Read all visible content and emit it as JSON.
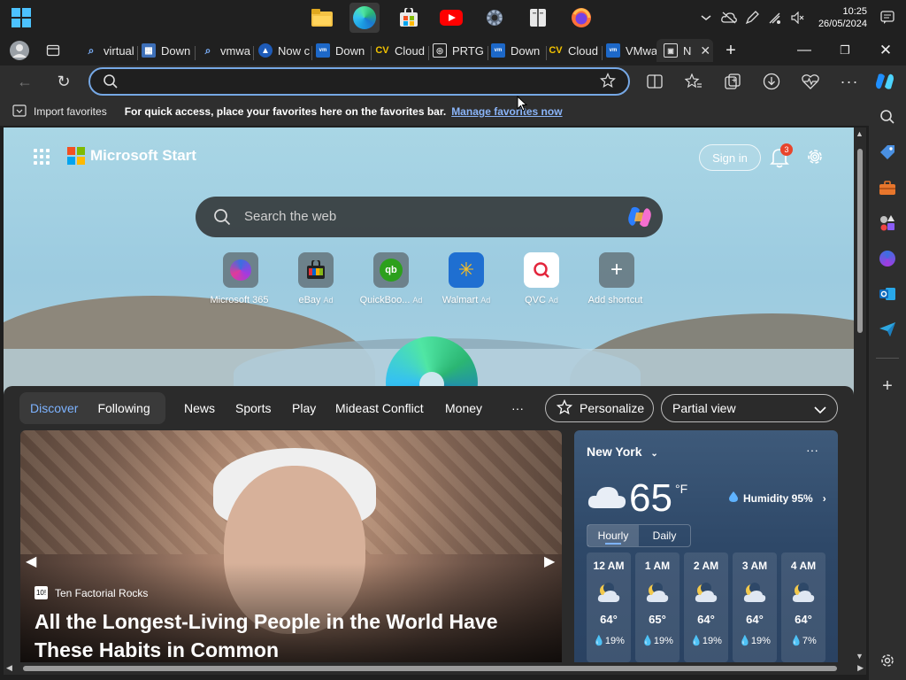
{
  "taskbar": {
    "start_icon": "windows-start-icon",
    "apps": [
      "file-explorer-icon",
      "edge-icon",
      "microsoft-store-icon",
      "youtube-icon",
      "settings-icon",
      "reader-icon",
      "firefox-icon"
    ],
    "time": "10:25",
    "date": "26/05/2024"
  },
  "tabs": [
    {
      "label": "virtual",
      "icon": "search-icon"
    },
    {
      "label": "Down",
      "icon": "site-icon"
    },
    {
      "label": "vmwa",
      "icon": "search-icon"
    },
    {
      "label": "Now c",
      "icon": "site-icon"
    },
    {
      "label": "Down",
      "icon": "vmware-icon"
    },
    {
      "label": "Cloud",
      "icon": "cv-icon"
    },
    {
      "label": "PRTG",
      "icon": "prtg-icon"
    },
    {
      "label": "Down",
      "icon": "vmware-icon"
    },
    {
      "label": "Cloud",
      "icon": "cv-icon"
    },
    {
      "label": "VMwa",
      "icon": "vmware-icon"
    },
    {
      "label": "N",
      "icon": "new-tab-icon"
    }
  ],
  "favorites_bar": {
    "import_label": "Import favorites",
    "message": "For quick access, place your favorites here on the favorites bar.",
    "link": "Manage favorites now"
  },
  "header": {
    "brand": "Microsoft Start",
    "sign_in": "Sign in",
    "notification_count": "3"
  },
  "search": {
    "placeholder": "Search the web"
  },
  "shortcuts": [
    {
      "label": "Microsoft 365",
      "ad": ""
    },
    {
      "label": "eBay",
      "ad": "Ad"
    },
    {
      "label": "QuickBoo...",
      "ad": "Ad"
    },
    {
      "label": "Walmart",
      "ad": "Ad"
    },
    {
      "label": "QVC",
      "ad": "Ad"
    },
    {
      "label": "Add shortcut",
      "ad": ""
    }
  ],
  "feed": {
    "discover": "Discover",
    "following": "Following",
    "tabs": [
      "News",
      "Sports",
      "Play",
      "Mideast Conflict",
      "Money",
      "···"
    ],
    "personalize": "Personalize",
    "view": "Partial view"
  },
  "article": {
    "source": "Ten Factorial Rocks",
    "source_icon_text": "10!",
    "headline": "All the Longest-Living People in the World Have These Habits in Common"
  },
  "weather": {
    "city": "New York",
    "more": "···",
    "temp": "65",
    "unit": "°F",
    "humidity": "Humidity 95%",
    "tab_hourly": "Hourly",
    "tab_daily": "Daily",
    "hours": [
      {
        "time": "12 AM",
        "temp": "64°",
        "precip": "19%"
      },
      {
        "time": "1 AM",
        "temp": "65°",
        "precip": "19%"
      },
      {
        "time": "2 AM",
        "temp": "64°",
        "precip": "19%"
      },
      {
        "time": "3 AM",
        "temp": "64°",
        "precip": "19%"
      },
      {
        "time": "4 AM",
        "temp": "64°",
        "precip": "7%"
      }
    ]
  },
  "colors": {
    "accent": "#76a8e5",
    "link": "#8ab4f8",
    "badge": "#e8452c"
  }
}
